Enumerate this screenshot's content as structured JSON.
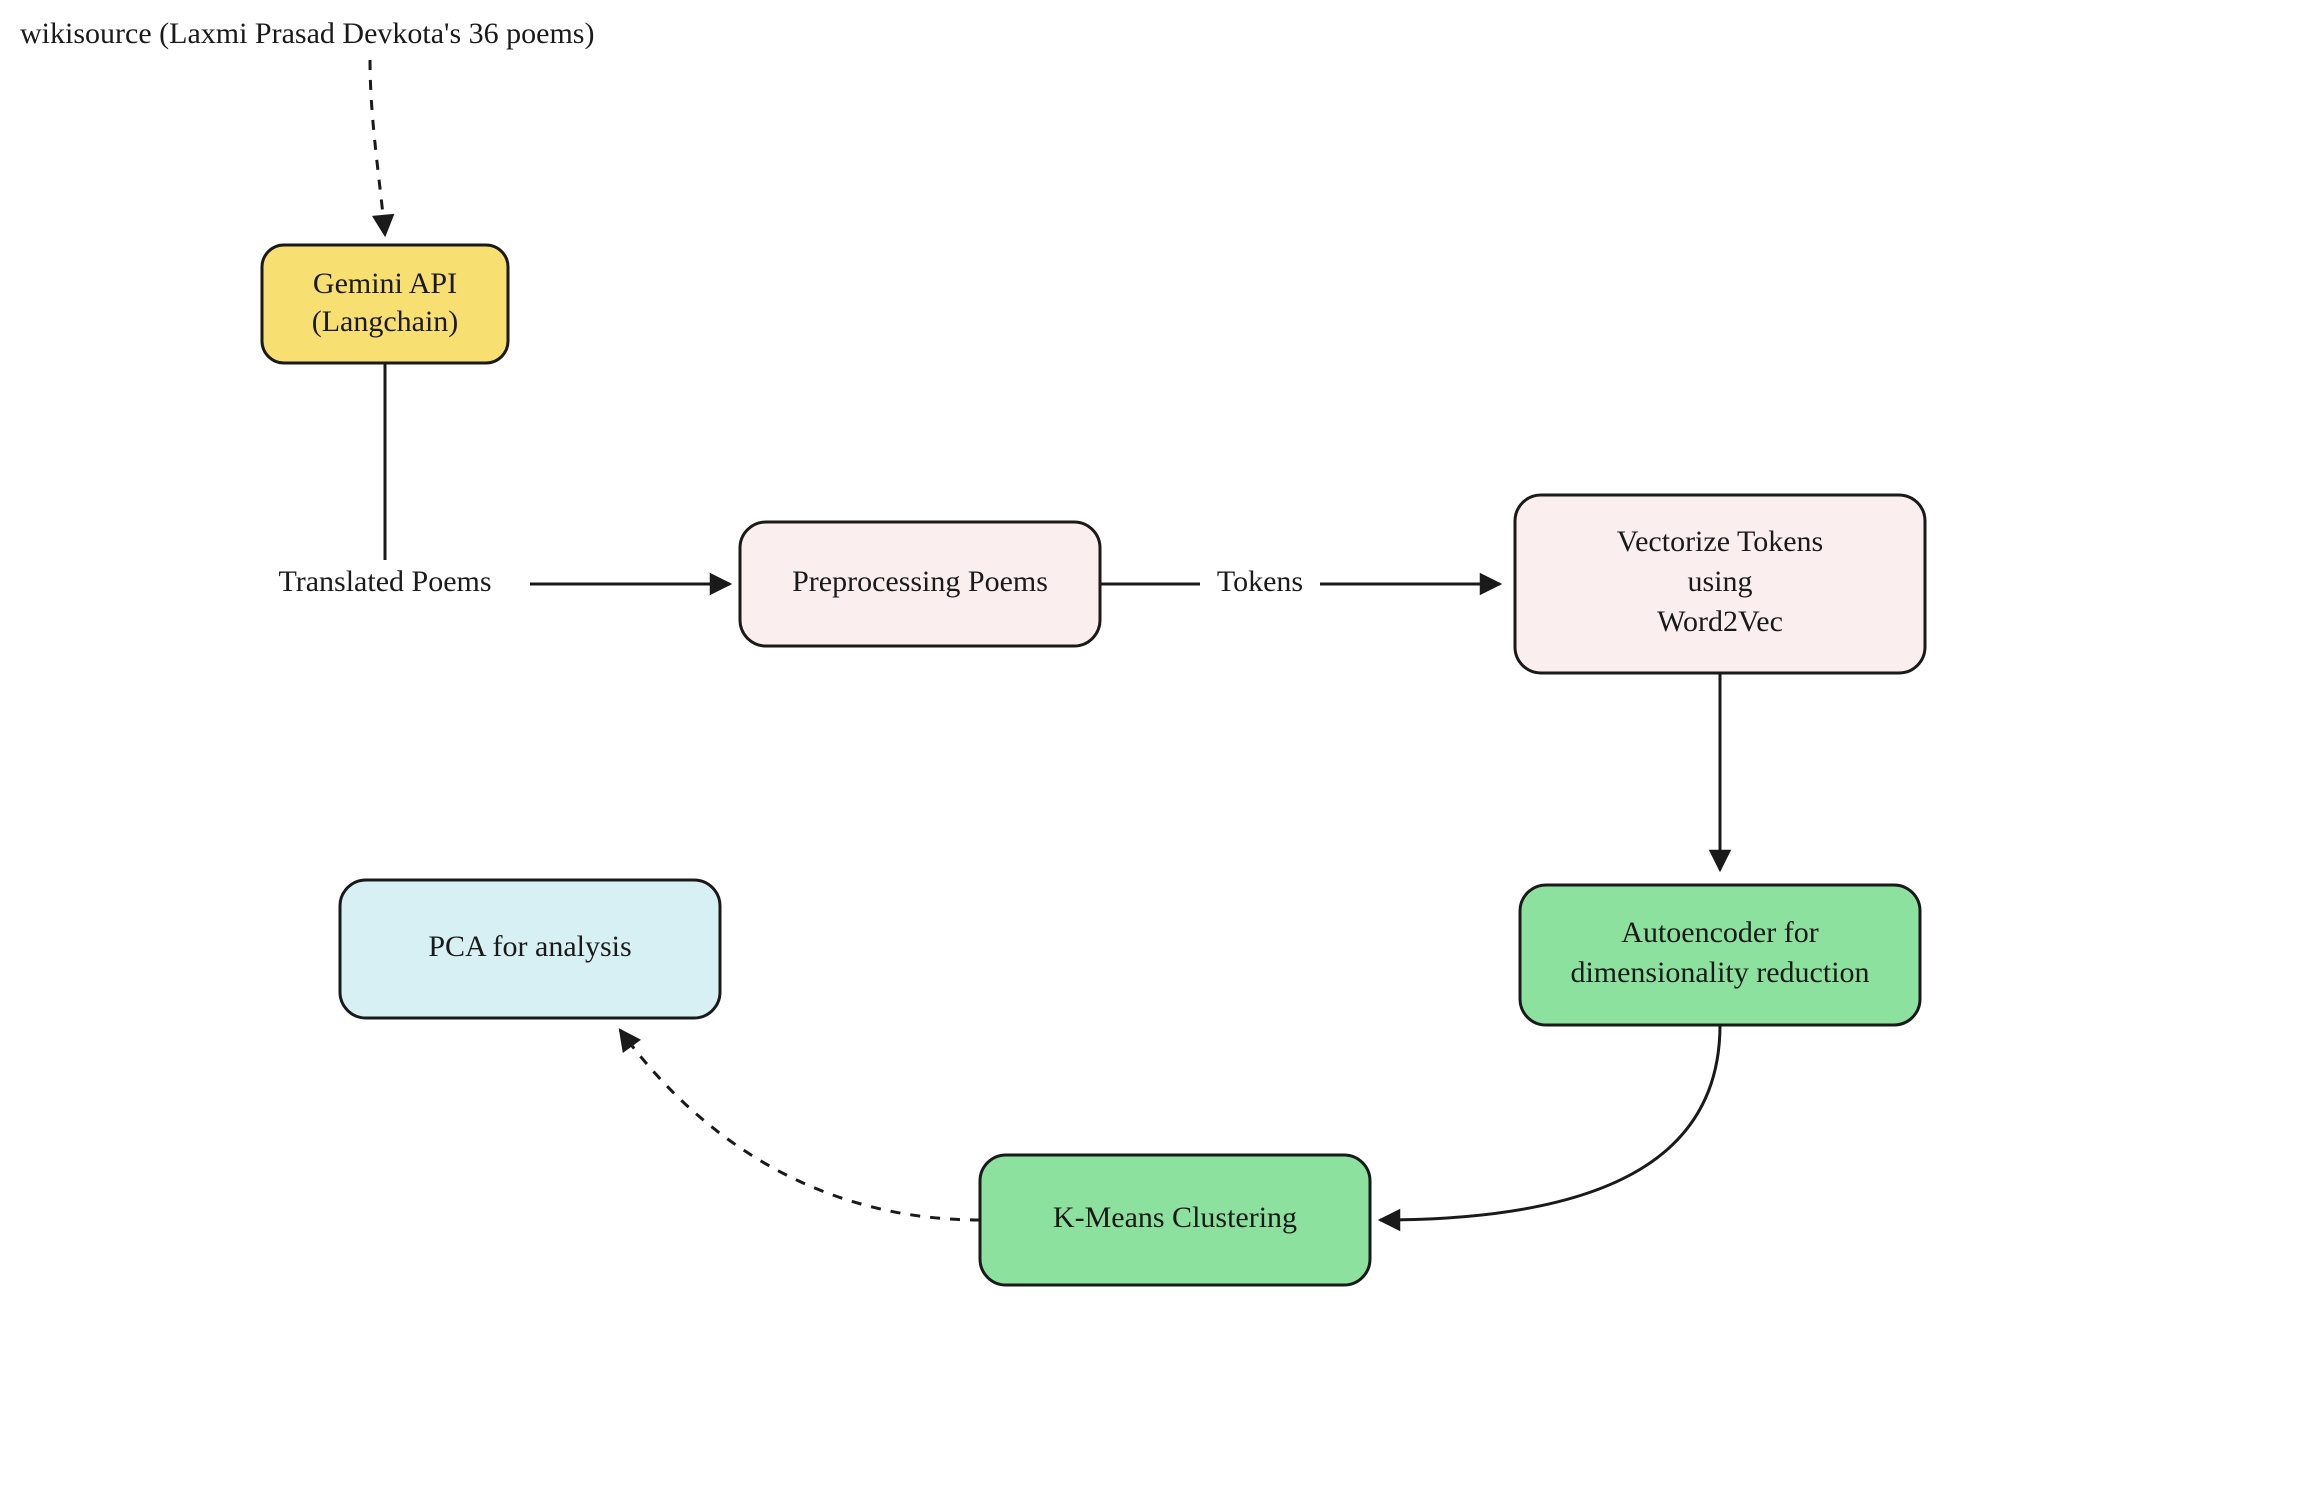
{
  "source_label": "wikisource (Laxmi Prasad Devkota's 36 poems)",
  "nodes": {
    "gemini": {
      "line1": "Gemini API",
      "line2": "(Langchain)",
      "fill": "#f7df72"
    },
    "preprocess": {
      "line1": "Preprocessing Poems",
      "fill": "#faeeee"
    },
    "vectorize": {
      "line1": "Vectorize Tokens",
      "line2": "using",
      "line3": "Word2Vec",
      "fill": "#faeeee"
    },
    "autoencoder": {
      "line1": "Autoencoder for",
      "line2": "dimensionality reduction",
      "fill": "#8ce19e"
    },
    "kmeans": {
      "line1": "K-Means Clustering",
      "fill": "#8ce19e"
    },
    "pca": {
      "line1": "PCA for analysis",
      "fill": "#d7f0f4"
    }
  },
  "edges": {
    "translated": "Translated Poems",
    "tokens": "Tokens"
  }
}
